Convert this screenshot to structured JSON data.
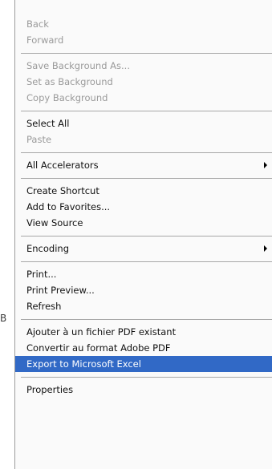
{
  "stray_text": "B",
  "menu": {
    "group_nav": [
      "Back",
      "Forward"
    ],
    "group_background": [
      "Save Background As...",
      "Set as Background",
      "Copy Background"
    ],
    "group_edit": [
      "Select All",
      "Paste"
    ],
    "group_accel": [
      "All Accelerators"
    ],
    "group_page": [
      "Create Shortcut",
      "Add to Favorites...",
      "View Source"
    ],
    "group_encoding": [
      "Encoding"
    ],
    "group_print": [
      "Print...",
      "Print Preview...",
      "Refresh"
    ],
    "group_pdf": [
      "Ajouter à un fichier PDF existant",
      "Convertir au format Adobe PDF",
      "Export to Microsoft Excel"
    ],
    "group_props": [
      "Properties"
    ],
    "highlighted_item": "Export to Microsoft Excel",
    "submenu_arrow_icon": "triangle-right-icon"
  },
  "colors": {
    "highlight": "#3169c6",
    "disabled_text": "#9a9a9a",
    "menu_background": "#fafafa"
  }
}
